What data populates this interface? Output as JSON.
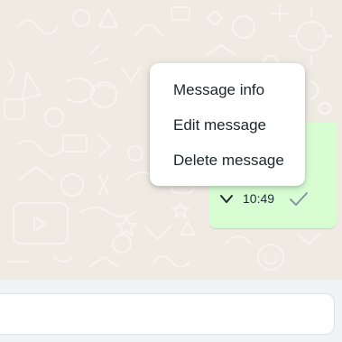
{
  "context_menu": {
    "items": [
      {
        "label": "Message info"
      },
      {
        "label": "Edit message"
      },
      {
        "label": "Delete message"
      }
    ]
  },
  "message": {
    "time": "10:49",
    "status_icon": "single-check-icon",
    "menu_icon": "chevron-down-icon",
    "bubble_color": "#d9fdd3"
  },
  "composer": {
    "value": "",
    "placeholder": ""
  },
  "colors": {
    "wallpaper": "#efeae2",
    "footer": "#f0f2f5",
    "menu": "#ffffff",
    "tick": "#8696a0"
  }
}
